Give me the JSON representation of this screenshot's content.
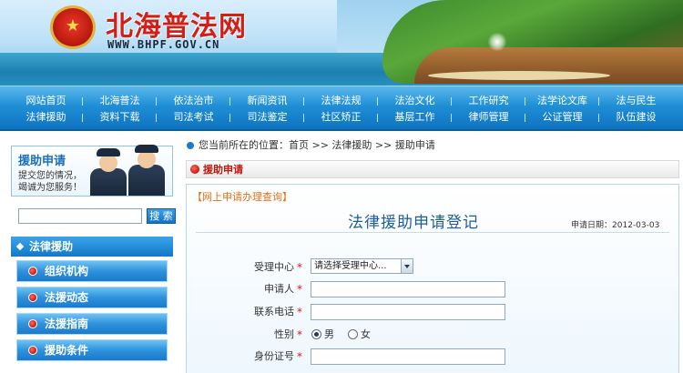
{
  "header": {
    "site_title": "北海普法网",
    "site_url": "WWW.BHPF.GOV.CN",
    "emblem_glyph": "★"
  },
  "nav": {
    "row1": [
      "网站首页",
      "北海普法",
      "依法治市",
      "新闻资讯",
      "法律法规",
      "法治文化",
      "工作研究",
      "法学论文库",
      "法与民生"
    ],
    "row2": [
      "法律援助",
      "资料下载",
      "司法考试",
      "司法鉴定",
      "社区矫正",
      "基层工作",
      "律师管理",
      "公证管理",
      "队伍建设"
    ]
  },
  "sidebar": {
    "aid_title": "援助申请",
    "aid_text": "提交您的情况，竭诚为您服务！",
    "search_placeholder": "",
    "search_button": "搜 索",
    "section_title": "法律援助",
    "items": [
      "组织机构",
      "法援动态",
      "法援指南",
      "援助条件"
    ]
  },
  "main": {
    "breadcrumb": "您当前所在的位置：首页  >>  法律援助  >>  援助申请",
    "section_title": "援助申请",
    "query_link": "【网上申请办理查询】",
    "form_title": "法律援助申请登记",
    "apply_date_label": "申请日期：",
    "apply_date": "2012-03-03",
    "fields": {
      "center_label": "受理中心",
      "center_select": "请选择受理中心...",
      "applicant_label": "申请人",
      "phone_label": "联系电话",
      "gender_label": "性别",
      "gender_male": "男",
      "gender_female": "女",
      "id_label": "身份证号"
    },
    "required_mark": "*"
  },
  "colors": {
    "nav_blue": "#1f8fd6",
    "title_red": "#d0201a",
    "heading_blue": "#1b5d9c",
    "link_orange": "#e0701c"
  }
}
